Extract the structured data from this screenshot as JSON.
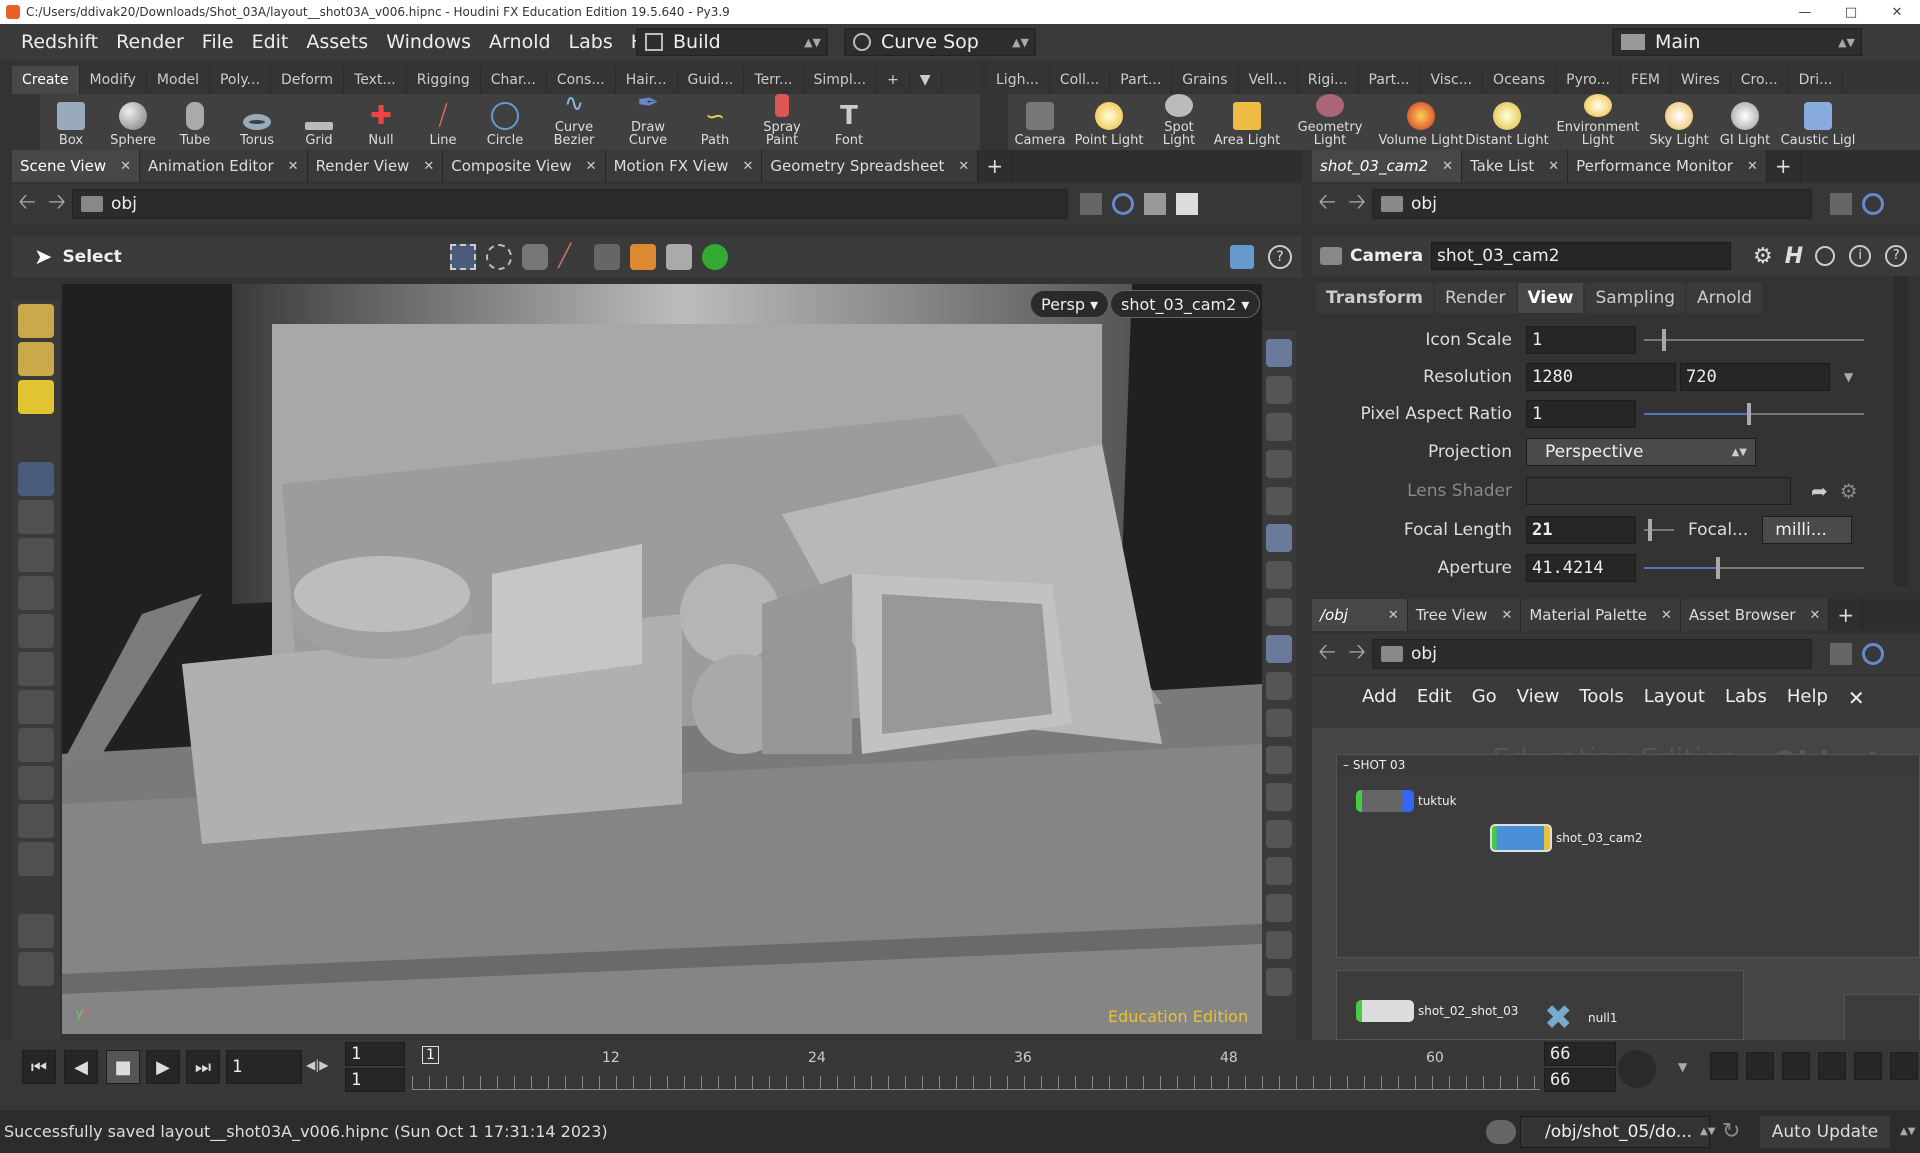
{
  "window": {
    "title": "C:/Users/ddivak20/Downloads/Shot_03A/layout__shot03A_v006.hipnc - Houdini FX Education Edition 19.5.640 - Py3.9"
  },
  "menu": [
    "Redshift",
    "Render",
    "File",
    "Edit",
    "Assets",
    "Windows",
    "Arnold",
    "Labs",
    "Help"
  ],
  "desktop": {
    "label": "Build"
  },
  "sop_combo": {
    "label": "Curve Sop"
  },
  "main_combo": {
    "label": "Main"
  },
  "shelf_tabs_left": [
    "Create",
    "Modify",
    "Model",
    "Poly...",
    "Deform",
    "Text...",
    "Rigging",
    "Char...",
    "Cons...",
    "Hair...",
    "Guid...",
    "Terr...",
    "Simpl..."
  ],
  "shelf_tabs_right": [
    "Ligh...",
    "Coll...",
    "Part...",
    "Grains",
    "Vell...",
    "Rigi...",
    "Part...",
    "Visc...",
    "Oceans",
    "Pyro...",
    "FEM",
    "Wires",
    "Cro...",
    "Dri..."
  ],
  "tools_left": [
    "Box",
    "Sphere",
    "Tube",
    "Torus",
    "Grid",
    "Null",
    "Line",
    "Circle",
    "Curve Bezier",
    "Draw Curve",
    "Path",
    "Spray Paint",
    "Font"
  ],
  "tools_right": [
    "Camera",
    "Point Light",
    "Spot Light",
    "Area Light",
    "Geometry Light",
    "Volume Light",
    "Distant Light",
    "Environment Light",
    "Sky Light",
    "GI Light",
    "Caustic Ligl"
  ],
  "pane_tabs_left": [
    "Scene View",
    "Animation Editor",
    "Render View",
    "Composite View",
    "Motion FX View",
    "Geometry Spreadsheet"
  ],
  "pane_tabs_right_top": [
    "shot_03_cam2",
    "Take List",
    "Performance Monitor"
  ],
  "pane_tabs_right_bottom": [
    "/obj",
    "Tree View",
    "Material Palette",
    "Asset Browser"
  ],
  "path": {
    "left": "obj",
    "right_top": "obj",
    "right_bottom": "obj"
  },
  "viewport": {
    "select_label": "Select",
    "persp": "Persp",
    "camera": "shot_03_cam2",
    "watermark": "Education Edition"
  },
  "params": {
    "type_label": "Camera",
    "node_name": "shot_03_cam2",
    "tabs": [
      "Transform",
      "Render",
      "View",
      "Sampling",
      "Arnold"
    ],
    "icon_scale_label": "Icon Scale",
    "icon_scale": "1",
    "resolution_label": "Resolution",
    "res_x": "1280",
    "res_y": "720",
    "pixel_aspect_label": "Pixel Aspect Ratio",
    "pixel_aspect": "1",
    "projection_label": "Projection",
    "projection": "Perspective",
    "lens_shader_label": "Lens Shader",
    "focal_length_label": "Focal Length",
    "focal_length": "21",
    "focal_units_label": "Focal...",
    "focal_units": "milli...",
    "aperture_label": "Aperture",
    "aperture": "41.4214"
  },
  "network": {
    "menu": [
      "Add",
      "Edit",
      "Go",
      "View",
      "Tools",
      "Layout",
      "Labs",
      "Help"
    ],
    "wm_edition": "Education Edition",
    "wm_context": "Objects",
    "box_title": "SHOT 03",
    "nodes": [
      "tuktuk",
      "shot_03_cam2",
      "shot_02_shot_03",
      "null1"
    ]
  },
  "timeline": {
    "frame": "1",
    "start": "1",
    "start2": "1",
    "end": "66",
    "end2": "66",
    "ticks": [
      "1",
      "12",
      "24",
      "36",
      "48",
      "60"
    ]
  },
  "status": {
    "message": "Successfully saved layout__shot03A_v006.hipnc (Sun Oct  1 17:31:14 2023)",
    "path": "/obj/shot_05/do...",
    "update": "Auto Update"
  }
}
